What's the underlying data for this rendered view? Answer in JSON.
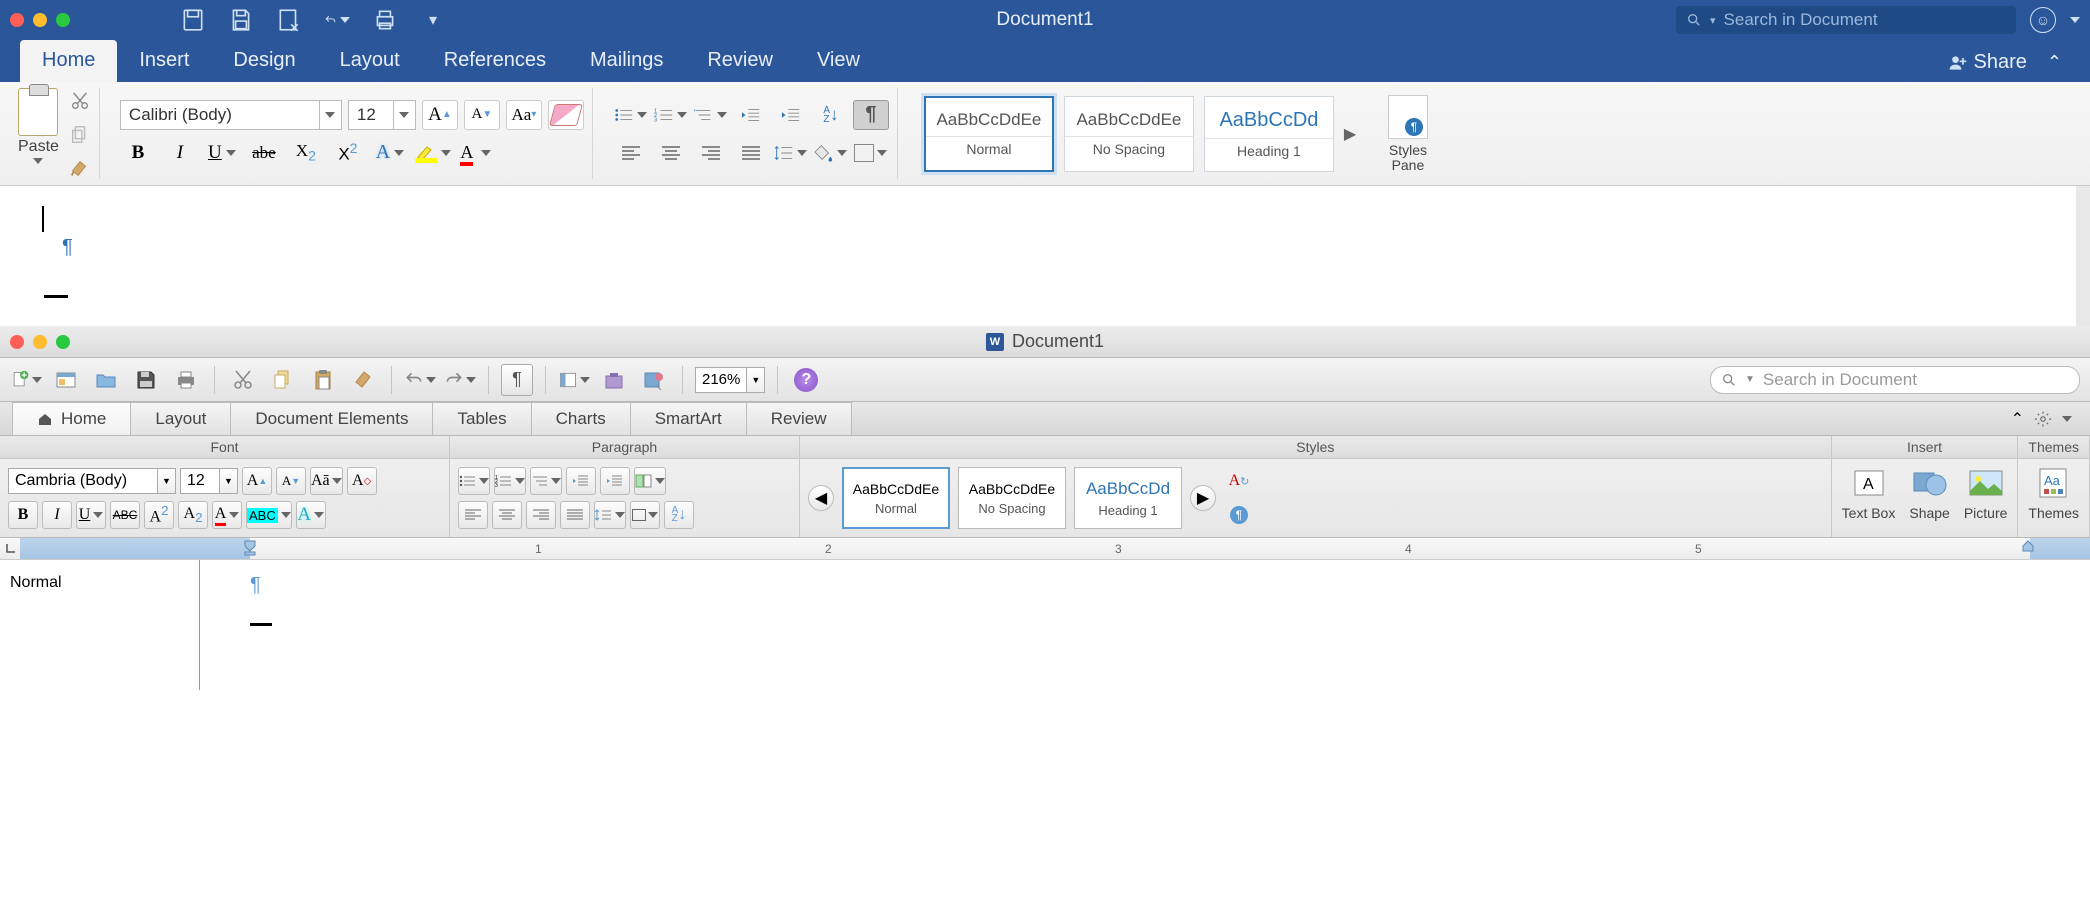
{
  "w1": {
    "title": "Document1",
    "search_placeholder": "Search in Document",
    "share": "Share",
    "tabs": [
      "Home",
      "Insert",
      "Design",
      "Layout",
      "References",
      "Mailings",
      "Review",
      "View"
    ],
    "paste": "Paste",
    "font_name": "Calibri (Body)",
    "font_size": "12",
    "styles": [
      {
        "preview": "AaBbCcDdEe",
        "name": "Normal"
      },
      {
        "preview": "AaBbCcDdEe",
        "name": "No Spacing"
      },
      {
        "preview": "AaBbCcDd",
        "name": "Heading 1"
      }
    ],
    "pane": "Styles\nPane"
  },
  "w2": {
    "title": "Document1",
    "zoom": "216%",
    "search_placeholder": "Search in Document",
    "tabs": [
      "Home",
      "Layout",
      "Document Elements",
      "Tables",
      "Charts",
      "SmartArt",
      "Review"
    ],
    "groups": {
      "font": "Font",
      "para": "Paragraph",
      "styles": "Styles",
      "insert": "Insert",
      "themes": "Themes"
    },
    "font_name": "Cambria (Body)",
    "font_size": "12",
    "styles": [
      {
        "preview": "AaBbCcDdEe",
        "name": "Normal"
      },
      {
        "preview": "AaBbCcDdEe",
        "name": "No Spacing"
      },
      {
        "preview": "AaBbCcDd",
        "name": "Heading 1"
      }
    ],
    "insert": [
      "Text Box",
      "Shape",
      "Picture",
      "Themes"
    ],
    "ruler_ticks": [
      "1",
      "2",
      "3",
      "4",
      "5"
    ],
    "style_area": "Normal"
  }
}
